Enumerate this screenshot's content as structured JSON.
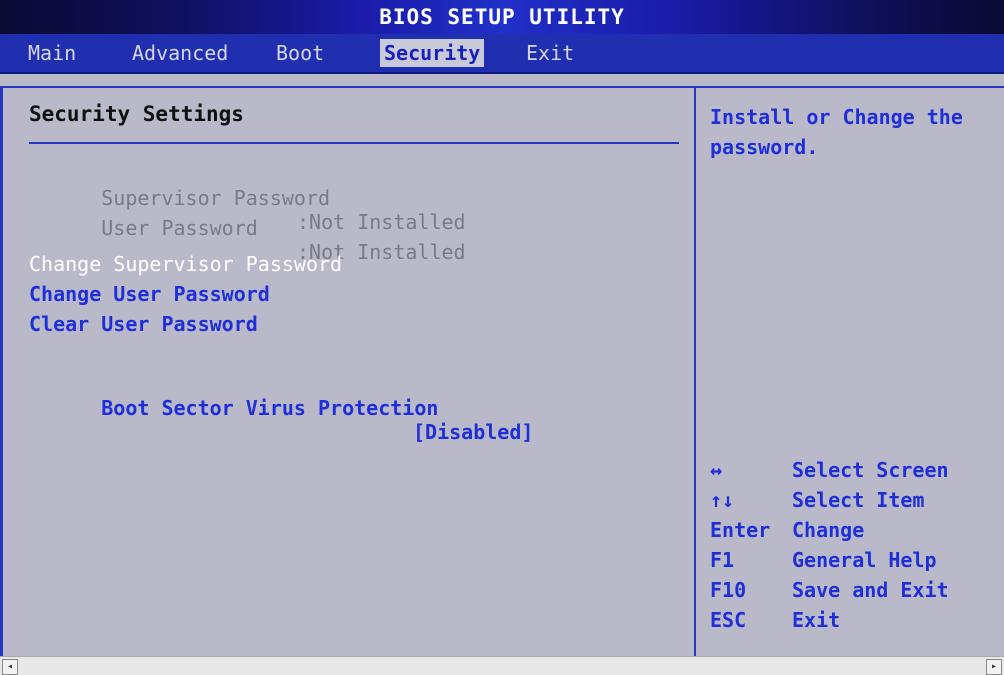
{
  "title": "BIOS SETUP UTILITY",
  "menu": [
    {
      "label": "Main",
      "active": false
    },
    {
      "label": "Advanced",
      "active": false
    },
    {
      "label": "Boot",
      "active": false
    },
    {
      "label": "Security",
      "active": true
    },
    {
      "label": "Exit",
      "active": false
    }
  ],
  "section_title": "Security Settings",
  "status_rows": [
    {
      "label": "Supervisor Password",
      "value": ":Not Installed"
    },
    {
      "label": "User Password",
      "value": ":Not Installed"
    }
  ],
  "actions": [
    {
      "label": "Change Supervisor Password"
    },
    {
      "label": "Change User Password"
    },
    {
      "label": "Clear User Password"
    }
  ],
  "setting": {
    "label": "Boot Sector Virus Protection",
    "value": "[Disabled]"
  },
  "help_text": "Install or Change the password.",
  "keys": [
    {
      "key": "↔",
      "desc": "Select Screen"
    },
    {
      "key": "↑↓",
      "desc": "Select Item"
    },
    {
      "key": "Enter",
      "desc": "Change"
    },
    {
      "key": "F1",
      "desc": "General Help"
    },
    {
      "key": "F10",
      "desc": "Save and Exit"
    },
    {
      "key": "ESC",
      "desc": "Exit"
    }
  ],
  "colors": {
    "accent": "#1f2fd8",
    "menu_bg": "#1f2fb0",
    "panel_bg": "#b9b9c9"
  }
}
